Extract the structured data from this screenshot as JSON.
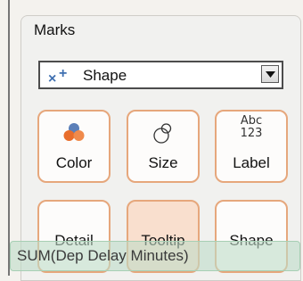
{
  "marks": {
    "title": "Marks",
    "mark_type": {
      "label": "Shape",
      "icon": "shape-mark-icon"
    },
    "buttons": [
      {
        "label": "Color",
        "icon": "color-icon"
      },
      {
        "label": "Size",
        "icon": "size-icon"
      },
      {
        "label": "Label",
        "icon": "label-icon",
        "icon_text_top": "Abc",
        "icon_text_bottom": "123"
      },
      {
        "label": "Detail",
        "icon": "detail-icon"
      },
      {
        "label": "Tooltip",
        "icon": "tooltip-icon"
      },
      {
        "label": "Shape",
        "icon": "shape-icon"
      }
    ]
  },
  "drag_field": {
    "label": "SUM(Dep Delay Minutes)"
  },
  "colors": {
    "card_border": "#e6a77c",
    "card_hover_bg": "#f9dfce",
    "shape_icon_blue": "#3e6fb0",
    "color_icon_blue": "#5b7fb8",
    "color_icon_orange": "#e86d2b",
    "drag_pill_bg": "#bedcc8"
  }
}
